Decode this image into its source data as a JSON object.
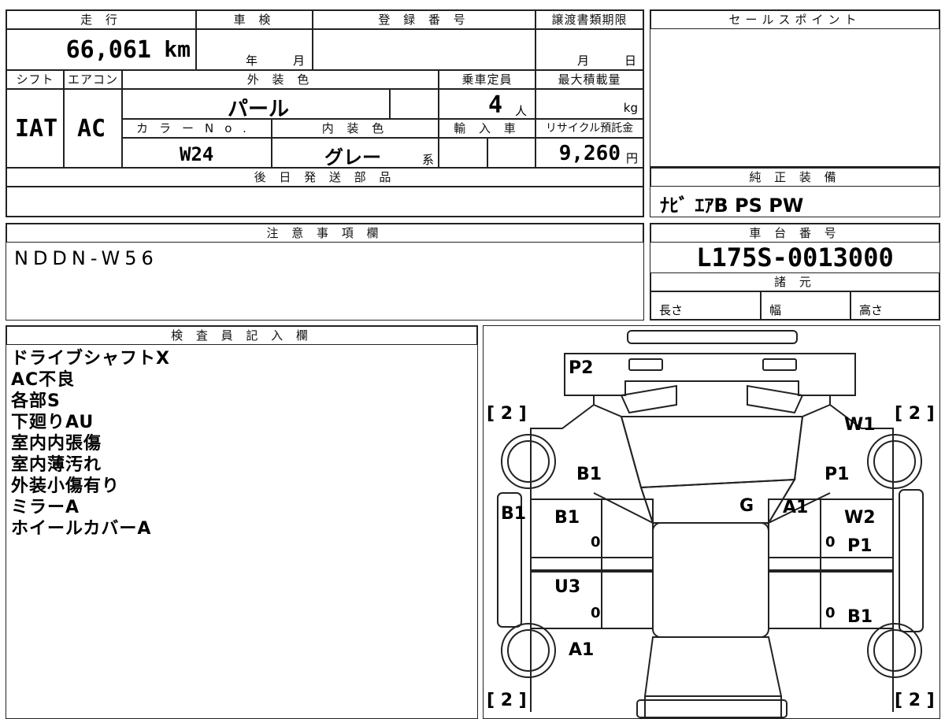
{
  "top": {
    "mileage_label": "走 行",
    "mileage_value": "66,061",
    "mileage_unit": "km",
    "shaken_label": "車 検",
    "shaken_year": "年",
    "shaken_month": "月",
    "reg_label": "登 録 番 号",
    "transfer_label": "譲渡書類期限",
    "transfer_month": "月",
    "transfer_day": "日",
    "shift_label": "シフト",
    "shift_value": "IAT",
    "ac_label": "エアコン",
    "ac_value": "AC",
    "exterior_label": "外 装 色",
    "exterior_value": "パール",
    "capacity_label": "乗車定員",
    "capacity_value": "4",
    "capacity_unit": "人",
    "maxload_label": "最大積載量",
    "maxload_unit": "kg",
    "color_no_label": "カラーNo.",
    "color_no_value": "W24",
    "interior_label": "内 装 色",
    "interior_value": "グレー",
    "interior_suffix": "系",
    "import_label": "輸 入 車",
    "recycle_label": "リサイクル預託金",
    "recycle_value": "9,260",
    "recycle_unit": "円",
    "later_parts_label": "後 日 発 送 部 品"
  },
  "sales_point": {
    "label": "セールスポイント"
  },
  "equipment": {
    "label": "純 正 装 備",
    "value": "ﾅﾋﾞ ｴｱB PS PW"
  },
  "notes": {
    "label": "注 意 事 項 欄",
    "value": "NDDN-W56"
  },
  "chassis": {
    "label": "車 台 番 号",
    "value": "L175S-0013000",
    "spec_label": "諸 元",
    "length_label": "長さ",
    "width_label": "幅",
    "height_label": "高さ"
  },
  "inspector": {
    "label": "検 査 員 記 入 欄",
    "lines": [
      "ドライブシャフトX",
      "AC不良",
      "各部S",
      "下廻りAU",
      "室内内張傷",
      "室内薄汚れ",
      "外装小傷有り",
      "ミラーA",
      "ホイールカバーA"
    ]
  },
  "diagram": {
    "marks": [
      "P2",
      "W1",
      "B1",
      "P1",
      "G",
      "A1",
      "B1",
      "B1",
      "W2",
      "P1",
      "U3",
      "B1",
      "A1"
    ],
    "tire_counts": [
      "[ 2 ]",
      "[ 2 ]",
      "[ 2 ]",
      "[ 2 ]"
    ],
    "zero_marks": [
      "0",
      "0",
      "0",
      "0"
    ]
  }
}
